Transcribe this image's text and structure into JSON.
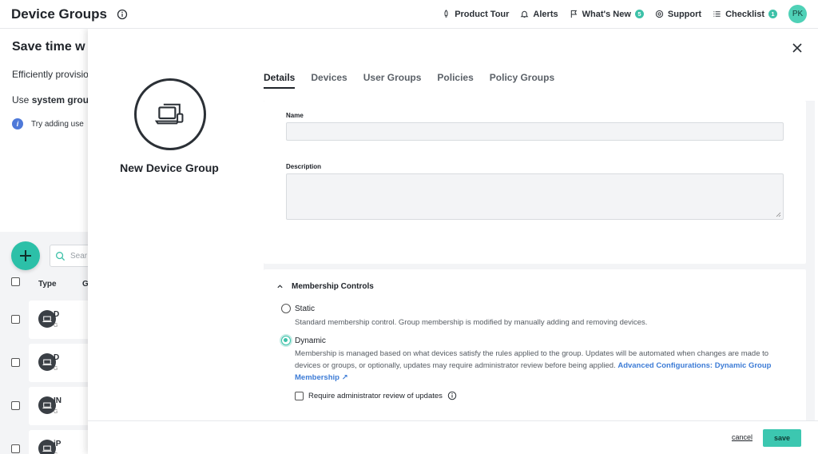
{
  "header": {
    "title": "Device Groups",
    "nav": [
      {
        "label": "Product Tour",
        "icon": "rocket-icon"
      },
      {
        "label": "Alerts",
        "icon": "bell-icon"
      },
      {
        "label": "What's New",
        "icon": "flag-icon",
        "badge": "5"
      },
      {
        "label": "Support",
        "icon": "lifebuoy-icon"
      },
      {
        "label": "Checklist",
        "icon": "list-icon",
        "badge": "1"
      }
    ],
    "avatar": "PK"
  },
  "background": {
    "promo_title": "Save time w",
    "promo_line1": "Efficiently provisio",
    "promo_line2_prefix": "Use ",
    "promo_line2_bold": "system grou",
    "tip": "Try adding use",
    "search_placeholder": "Sear",
    "columns": {
      "type": "Type",
      "group": "G"
    },
    "rows": [
      {
        "name": "D",
        "sub": "G"
      },
      {
        "name": "D",
        "sub": "G"
      },
      {
        "name": "IN",
        "sub": "G"
      },
      {
        "name": "iP",
        "sub": "G"
      }
    ]
  },
  "modal": {
    "group_name": "New Device Group",
    "tabs": [
      "Details",
      "Devices",
      "User Groups",
      "Policies",
      "Policy Groups"
    ],
    "active_tab": "Details",
    "details": {
      "name_label": "Name",
      "name_value": "",
      "description_label": "Description",
      "description_value": ""
    },
    "membership": {
      "title": "Membership Controls",
      "static_label": "Static",
      "static_desc": "Standard membership control. Group membership is modified by manually adding and removing devices.",
      "dynamic_label": "Dynamic",
      "dynamic_desc": "Membership is managed based on what devices satisfy the rules applied to the group. Updates will be automated when changes are made to devices or groups, or optionally, updates may require administrator review before being applied.",
      "dynamic_link": "Advanced Configurations: Dynamic Group Membership",
      "selected": "Dynamic",
      "review_label": "Require administrator review of updates",
      "review_checked": false
    },
    "footer": {
      "cancel": "cancel",
      "save": "save"
    }
  },
  "colors": {
    "accent": "#3cc1a8",
    "link": "#3d7cd6"
  }
}
